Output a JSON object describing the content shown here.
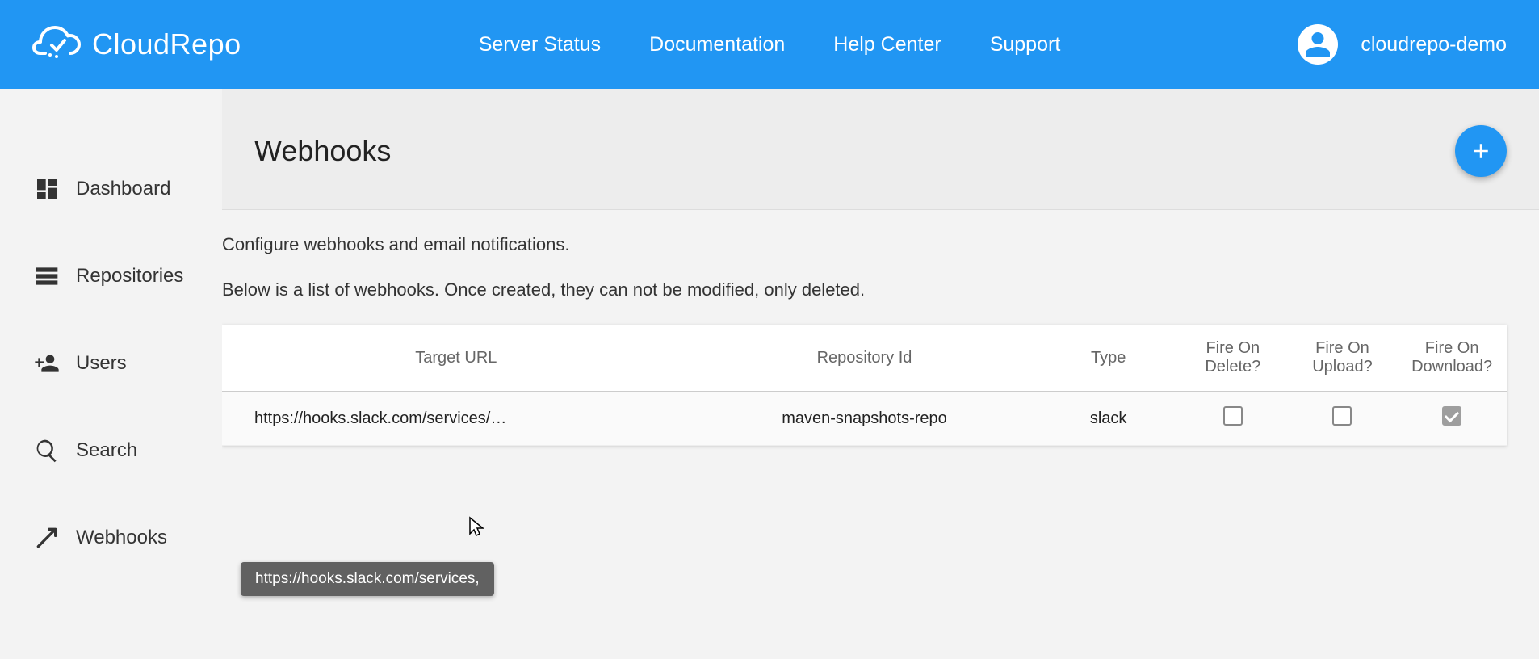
{
  "brand": {
    "name": "CloudRepo"
  },
  "topnav": {
    "server_status": "Server Status",
    "documentation": "Documentation",
    "help_center": "Help Center",
    "support": "Support"
  },
  "user": {
    "name": "cloudrepo-demo"
  },
  "sidebar": {
    "items": [
      {
        "label": "Dashboard"
      },
      {
        "label": "Repositories"
      },
      {
        "label": "Users"
      },
      {
        "label": "Search"
      },
      {
        "label": "Webhooks"
      }
    ]
  },
  "page": {
    "title": "Webhooks",
    "desc1": "Configure webhooks and email notifications.",
    "desc2": "Below is a list of webhooks. Once created, they can not be modified, only deleted."
  },
  "table": {
    "headers": {
      "target_url": "Target URL",
      "repo_id": "Repository Id",
      "type": "Type",
      "fire_delete": "Fire On Delete?",
      "fire_upload": "Fire On Upload?",
      "fire_download": "Fire On Download?"
    },
    "rows": [
      {
        "target_url": "https://hooks.slack.com/services/…",
        "repo_id": "maven-snapshots-repo",
        "type": "slack",
        "fire_delete": false,
        "fire_upload": false,
        "fire_download": true
      }
    ]
  },
  "tooltip": {
    "text": "https://hooks.slack.com/services,         "
  }
}
